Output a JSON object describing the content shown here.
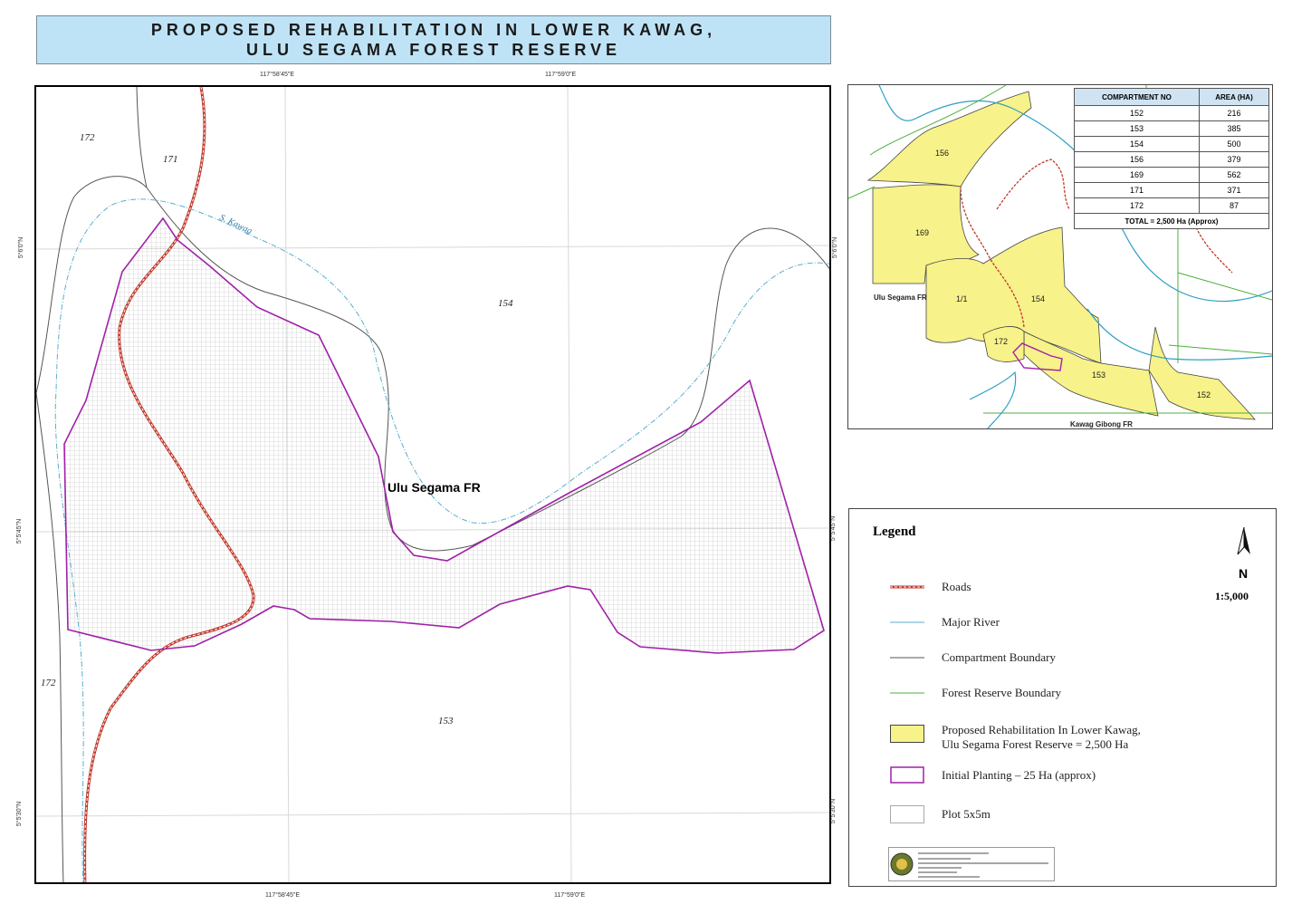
{
  "title": {
    "line1": "PROPOSED REHABILITATION IN LOWER KAWAG,",
    "line2": "ULU SEGAMA FOREST RESERVE"
  },
  "coordinates": {
    "top_1": "117°58'45\"E",
    "top_2": "117°59'0\"E",
    "bottom_1": "117°58'45\"E",
    "bottom_2": "117°59'0\"E",
    "left_1": "5°6'0\"N",
    "left_2": "5°5'45\"N",
    "left_3": "5°5'30\"N",
    "right_1": "5°6'0\"N",
    "right_2": "5°5'45\"N",
    "right_3": "5°5'30\"N"
  },
  "main_map": {
    "labels": {
      "c172_top": "172",
      "c171": "171",
      "river": "S. Kawag",
      "c154": "154",
      "reserve": "Ulu Segama FR",
      "c172_bottom": "172",
      "c153": "153"
    }
  },
  "inset": {
    "labels": {
      "c156": "156",
      "c169": "169",
      "c171": "1/1",
      "c154": "154",
      "c172": "172",
      "c153": "153",
      "c152": "152",
      "ulu_segama": "Ulu Segama FR",
      "kawag_gibong": "Kawag Gibong FR"
    },
    "table": {
      "headers": [
        "COMPARTMENT NO",
        "AREA (HA)"
      ],
      "rows": [
        {
          "compartment": "152",
          "area": "216"
        },
        {
          "compartment": "153",
          "area": "385"
        },
        {
          "compartment": "154",
          "area": "500"
        },
        {
          "compartment": "156",
          "area": "379"
        },
        {
          "compartment": "169",
          "area": "562"
        },
        {
          "compartment": "171",
          "area": "371"
        },
        {
          "compartment": "172",
          "area": "87"
        }
      ],
      "total": "TOTAL  =  2,500 Ha (Approx)"
    }
  },
  "legend": {
    "title": "Legend",
    "items": [
      {
        "label": "Roads"
      },
      {
        "label": "Major River"
      },
      {
        "label": "Compartment Boundary"
      },
      {
        "label": "Forest Reserve Boundary"
      },
      {
        "label": "Proposed Rehabilitation In Lower Kawag,",
        "label2": "Ulu Segama Forest Reserve  = 2,500 Ha"
      },
      {
        "label": "Initial Planting   – 25 Ha (approx)"
      },
      {
        "label": "Plot 5x5m"
      }
    ],
    "scale": "1:5,000",
    "north": "N"
  },
  "colors": {
    "title_bg": "#bfe3f6",
    "road": "#c0392b",
    "river": "#5aaecd",
    "compartment": "#555555",
    "reserve_boundary": "#4caf3c",
    "rehab_fill": "#f7f28a",
    "initial_planting": "#a020a8"
  }
}
